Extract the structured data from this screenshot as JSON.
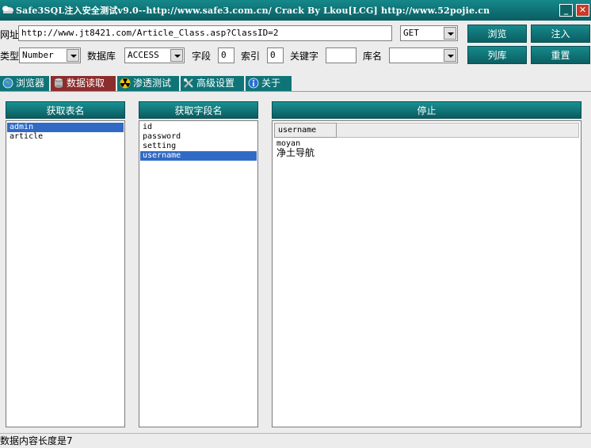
{
  "window": {
    "title": "Safe3SQL注入安全测试v9.0--http://www.safe3.com.cn/  Crack By Lkou[LCG]  http://www.52pojie.cn",
    "minimize_glyph": "_",
    "close_glyph": "✕"
  },
  "toolbar": {
    "url_label": "网址",
    "url_value": "http://www.jt8421.com/Article_Class.asp?ClassID=2",
    "method_value": "GET",
    "type_label": "类型",
    "type_value": "Number",
    "db_label": "数据库",
    "db_value": "ACCESS",
    "field_label": "字段",
    "field_value": "0",
    "index_label": "索引",
    "index_value": "0",
    "keyword_label": "关键字",
    "keyword_value": "",
    "dbname_label": "库名",
    "dbname_value": "",
    "browse_button": "浏览",
    "inject_button": "注入",
    "list_db_button": "列库",
    "reset_button": "重置"
  },
  "tabs": [
    {
      "label": "浏览器",
      "icon": "globe-icon"
    },
    {
      "label": "数据读取",
      "icon": "database-icon"
    },
    {
      "label": "渗透测试",
      "icon": "radiation-icon"
    },
    {
      "label": "高级设置",
      "icon": "tools-icon"
    },
    {
      "label": "关于",
      "icon": "info-icon"
    }
  ],
  "active_tab": "数据读取",
  "tables_panel": {
    "header": "获取表名",
    "items": [
      "admin",
      "article"
    ],
    "selected": "admin"
  },
  "fields_panel": {
    "header": "获取字段名",
    "items": [
      "id",
      "password",
      "setting",
      "username"
    ],
    "selected": "username"
  },
  "data_panel": {
    "header": "停止",
    "column": "username",
    "rows": [
      "moyan",
      "净土导航"
    ]
  },
  "statusbar": {
    "text": "数据内容长度是7"
  },
  "colors": {
    "accent_teal": "#0f7477",
    "active_tab": "#8c2d2d",
    "selection": "#316ac5",
    "close_button": "#c83a2a"
  }
}
